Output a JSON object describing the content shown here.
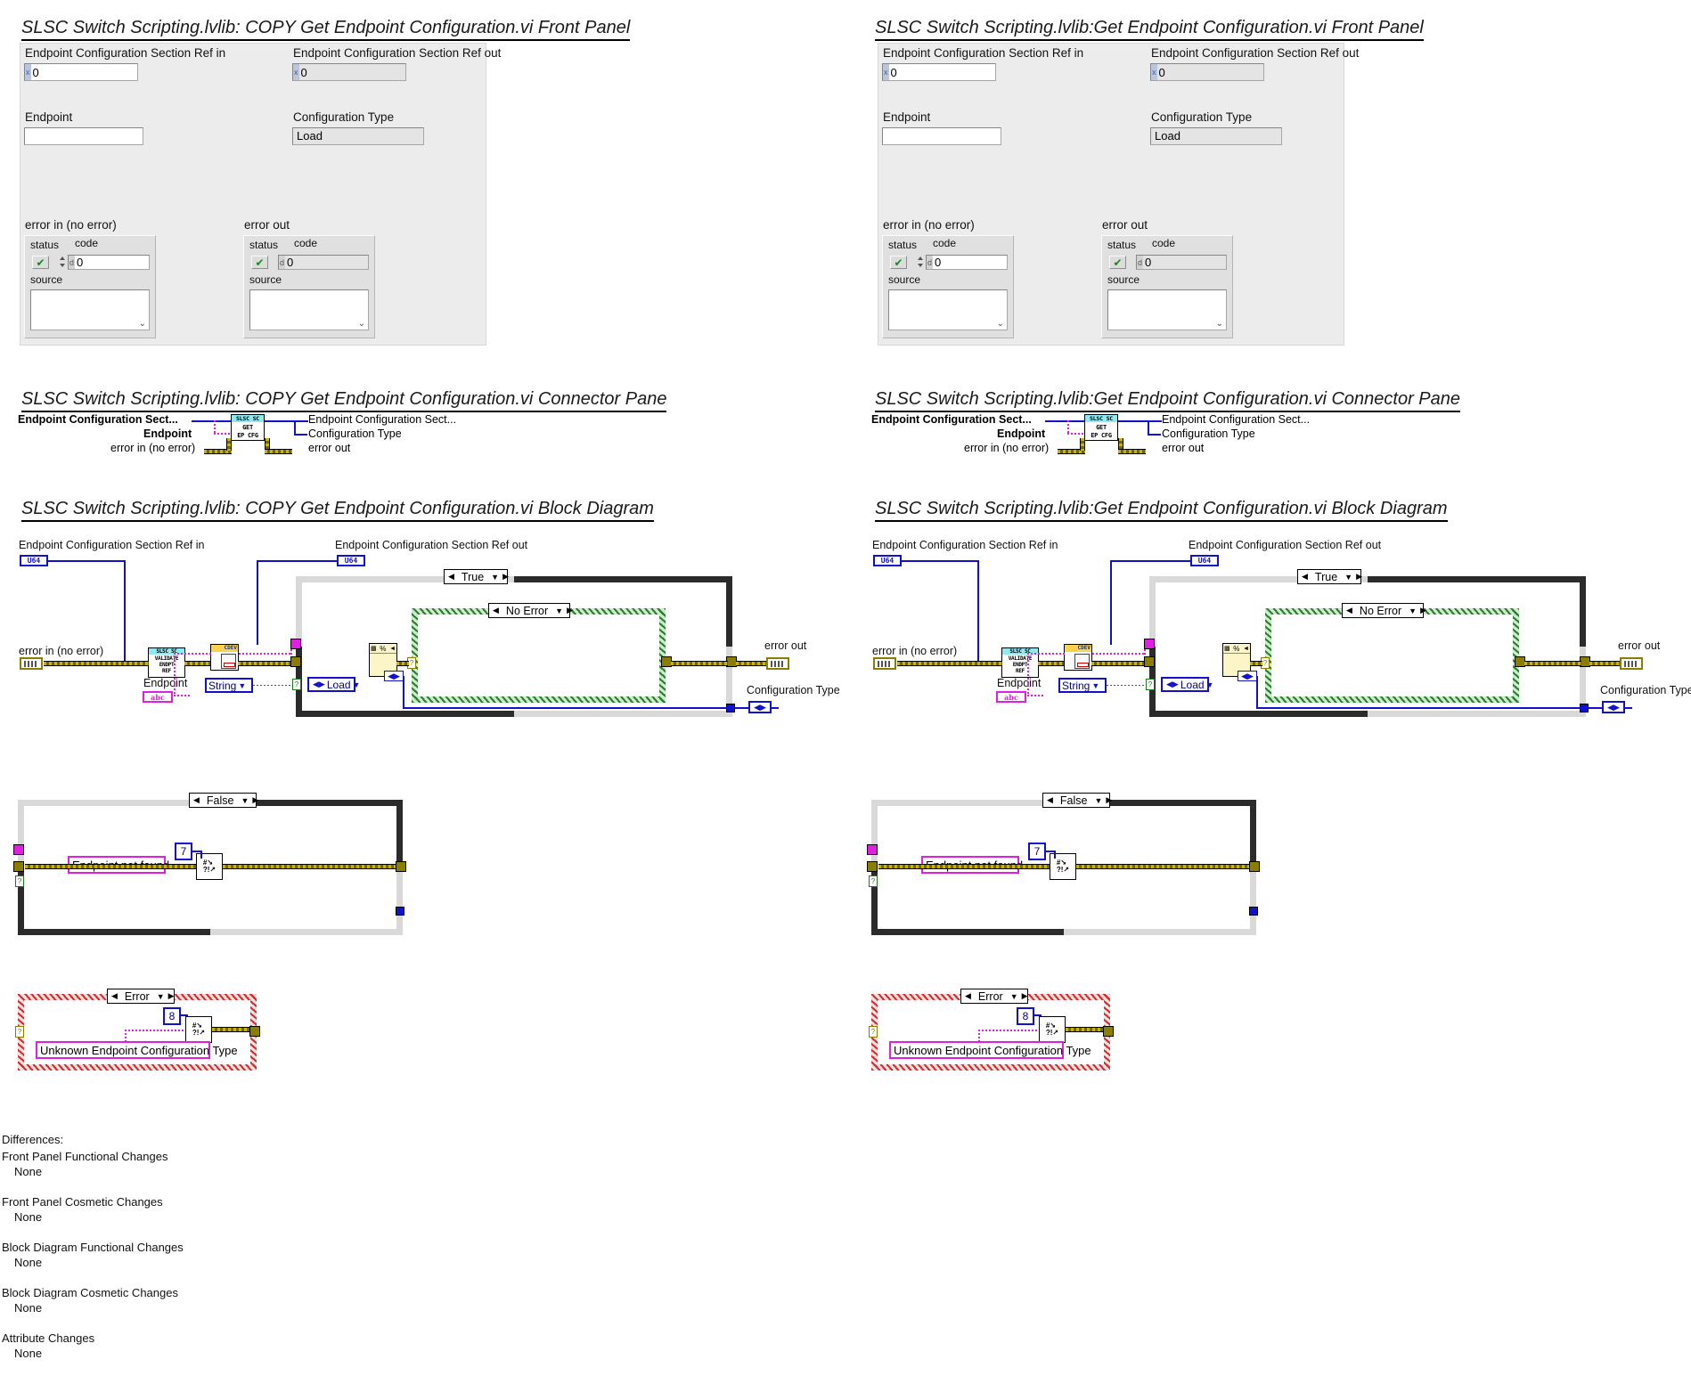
{
  "panels": [
    {
      "id": "left",
      "front_panel_title": "SLSC Switch Scripting.lvlib:  COPY  Get Endpoint Configuration.vi Front Panel",
      "connector_pane_title": "SLSC Switch Scripting.lvlib:  COPY  Get Endpoint Configuration.vi Connector Pane",
      "block_diagram_title": "SLSC Switch Scripting.lvlib:  COPY  Get Endpoint Configuration.vi Block Diagram"
    },
    {
      "id": "right",
      "front_panel_title": "SLSC Switch Scripting.lvlib:Get Endpoint Configuration.vi Front Panel",
      "connector_pane_title": "SLSC Switch Scripting.lvlib:Get Endpoint Configuration.vi Connector Pane",
      "block_diagram_title": "SLSC Switch Scripting.lvlib:Get Endpoint Configuration.vi Block Diagram"
    }
  ],
  "front_panel": {
    "ref_in_label": "Endpoint Configuration Section Ref in",
    "ref_in_value": "0",
    "ref_in_radix": "x",
    "ref_out_label": "Endpoint Configuration Section Ref out",
    "ref_out_value": "0",
    "ref_out_radix": "x",
    "endpoint_label": "Endpoint",
    "endpoint_value": "",
    "config_type_label": "Configuration Type",
    "config_type_value": "Load",
    "error_in_label": "error in (no error)",
    "error_out_label": "error out",
    "status_label": "status",
    "code_label": "code",
    "code_value": "0",
    "code_radix": "d",
    "source_label": "source",
    "source_value": "",
    "status_glyph": "check-mark-icon"
  },
  "connector_pane": {
    "inputs": [
      {
        "label": "Endpoint Configuration Sect...",
        "bold": true
      },
      {
        "label": "Endpoint",
        "bold": true
      },
      {
        "label": "error in (no error)",
        "bold": false
      }
    ],
    "outputs": [
      {
        "label": "Endpoint Configuration Sect..."
      },
      {
        "label": "Configuration Type"
      },
      {
        "label": "error out"
      }
    ],
    "icon": {
      "header": "SLSC SC",
      "line1": "GET",
      "line2": "EP CFG"
    }
  },
  "block_diagram": {
    "ref_in_label": "Endpoint Configuration Section Ref in",
    "ref_in_type": "U64",
    "ref_out_label": "Endpoint Configuration Section Ref out",
    "ref_out_type": "U64",
    "error_in_label": "error in (no error)",
    "error_out_label": "error out",
    "endpoint_label": "Endpoint",
    "endpoint_type": "abc",
    "config_type_label": "Configuration Type",
    "validate_subvi": {
      "header": "SLSC SC",
      "line1": "VALIDATE",
      "line2": "ENDPT",
      "line3": "REF"
    },
    "property_node": {
      "header": "CDEV",
      "name": "vi-server-property-node"
    },
    "string_dropdown": "String",
    "load_enum": "Load",
    "outer_case_selector": "True",
    "inner_case_selector": "No Error",
    "false_case": {
      "selector": "False",
      "error_code": "7",
      "message": "Endpoint not found"
    },
    "error_case": {
      "selector": "Error",
      "error_code": "8",
      "message": "Unknown Endpoint Configuration Type"
    }
  },
  "differences": {
    "heading": "Differences:",
    "sections": [
      {
        "title": "Front Panel Functional Changes",
        "value": "None"
      },
      {
        "title": "Front Panel Cosmetic Changes",
        "value": "None"
      },
      {
        "title": "Block Diagram Functional Changes",
        "value": "None"
      },
      {
        "title": "Block Diagram Cosmetic Changes",
        "value": "None"
      },
      {
        "title": "Attribute Changes",
        "value": "None"
      }
    ]
  },
  "colors": {
    "error_wire": "#b8a800",
    "string_wire": "#e020e0",
    "refnum_wire": "#1111cc",
    "icon_header": "#8fe9ef",
    "panel_bg": "#ececec"
  }
}
